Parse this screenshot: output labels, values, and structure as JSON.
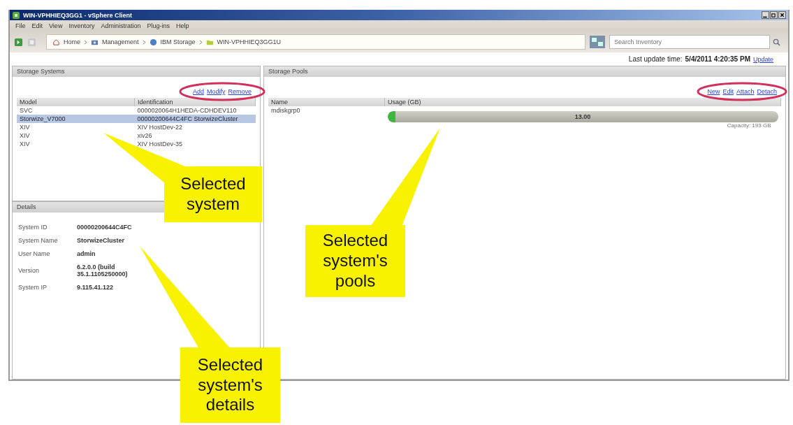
{
  "window": {
    "title": "WIN-VPHHIEQ3GG1 - vSphere Client"
  },
  "menu": [
    "File",
    "Edit",
    "View",
    "Inventory",
    "Administration",
    "Plug-ins",
    "Help"
  ],
  "breadcrumb": [
    "Home",
    "Management",
    "IBM Storage",
    "WIN-VPHHIEQ3GG1U"
  ],
  "search": {
    "placeholder": "Search Inventory"
  },
  "last_update": {
    "label": "Last update time:",
    "value": "5/4/2011 4:20:35 PM",
    "link": "Update"
  },
  "storage_systems": {
    "title": "Storage Systems",
    "circled": true,
    "actions": [
      "Add",
      "Modify",
      "Remove"
    ],
    "columns": [
      "Model",
      "Identification"
    ],
    "rows": [
      {
        "model": "SVC",
        "identification": "0000020064H1HEDA-CDHDEV110",
        "selected": false
      },
      {
        "model": "Storwize_V7000",
        "identification": "00000200644C4FC StorwizeCluster",
        "selected": true
      },
      {
        "model": "XIV",
        "identification": "XIV HostDev-22",
        "selected": false
      },
      {
        "model": "XIV",
        "identification": "xiv26",
        "selected": false
      },
      {
        "model": "XIV",
        "identification": "XIV HostDev-35",
        "selected": false
      }
    ]
  },
  "details": {
    "title": "Details",
    "fields": [
      {
        "label": "System ID",
        "value": "00000200644C4FC"
      },
      {
        "label": "System Name",
        "value": "StorwizeCluster"
      },
      {
        "label": "User Name",
        "value": "admin"
      },
      {
        "label": "Version",
        "value": "6.2.0.0 (build 35.1.1105250000)"
      },
      {
        "label": "System IP",
        "value": "9.115.41.122"
      }
    ]
  },
  "storage_pools": {
    "title": "Storage Pools",
    "circled": true,
    "actions": [
      "New",
      "Edit",
      "Attach",
      "Detach"
    ],
    "columns": [
      "Name",
      "Usage (GB)"
    ],
    "rows": [
      {
        "name": "mdiskgrp0",
        "level": 0.02,
        "usage": "13.00",
        "capacity": "Capacity: 193 GB"
      }
    ]
  },
  "callouts": [
    "Selected system",
    "Selected system's pools",
    "Selected system's details"
  ]
}
